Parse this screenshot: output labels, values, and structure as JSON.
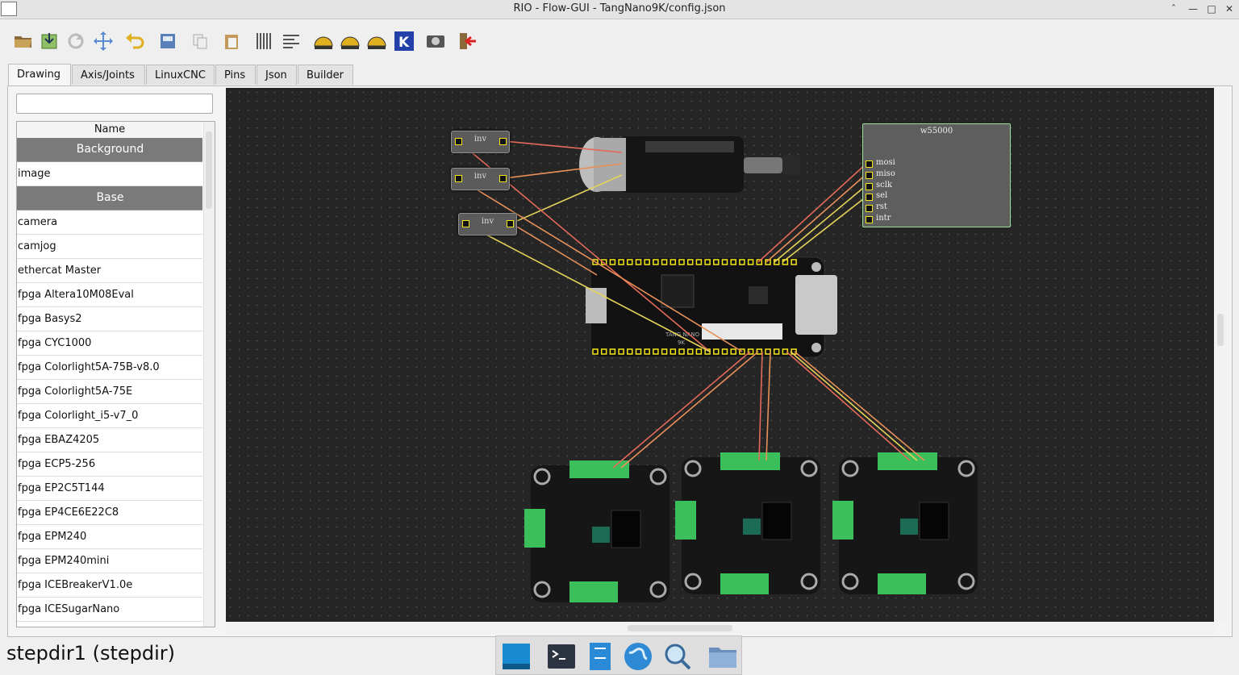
{
  "window": {
    "title": "RIO - Flow-GUI - TangNano9K/config.json"
  },
  "toolbar": {
    "icons": [
      "folder-open-icon",
      "save-download-icon",
      "reload-icon",
      "fit-view-icon",
      "undo-icon",
      "export-icon",
      "copy-icon",
      "paste-icon",
      "align-columns-icon",
      "align-text-icon",
      "linuxcnc-icon",
      "linuxcnc-alt-icon",
      "linuxcnc-run-icon",
      "kicad-icon",
      "screenshot-icon",
      "exit-icon"
    ]
  },
  "tabs": [
    "Drawing",
    "Axis/Joints",
    "LinuxCNC",
    "Pins",
    "Json",
    "Builder"
  ],
  "sidebar": {
    "search_placeholder": "",
    "header": "Name",
    "items": [
      {
        "label": "Background",
        "group": true
      },
      {
        "label": "image",
        "group": false
      },
      {
        "label": "Base",
        "group": true
      },
      {
        "label": "camera",
        "group": false
      },
      {
        "label": "camjog",
        "group": false
      },
      {
        "label": "ethercat Master",
        "group": false
      },
      {
        "label": "fpga Altera10M08Eval",
        "group": false
      },
      {
        "label": "fpga Basys2",
        "group": false
      },
      {
        "label": "fpga CYC1000",
        "group": false
      },
      {
        "label": "fpga Colorlight5A-75B-v8.0",
        "group": false
      },
      {
        "label": "fpga Colorlight5A-75E",
        "group": false
      },
      {
        "label": "fpga Colorlight_i5-v7_0",
        "group": false
      },
      {
        "label": "fpga EBAZ4205",
        "group": false
      },
      {
        "label": "fpga ECP5-256",
        "group": false
      },
      {
        "label": "fpga EP2C5T144",
        "group": false
      },
      {
        "label": "fpga EP4CE6E22C8",
        "group": false
      },
      {
        "label": "fpga EPM240",
        "group": false
      },
      {
        "label": "fpga EPM240mini",
        "group": false
      },
      {
        "label": "fpga ICEBreakerV1.0e",
        "group": false
      },
      {
        "label": "fpga ICESugarNano",
        "group": false
      }
    ]
  },
  "canvas": {
    "inv_nodes": [
      "inv",
      "inv",
      "inv"
    ],
    "w5500": {
      "title": "w55000",
      "pins": [
        "mosi",
        "miso",
        "sclk",
        "sel",
        "rst",
        "intr"
      ]
    },
    "board_text": [
      "TANG NANO",
      "9K"
    ]
  },
  "status": "stepdir1 (stepdir)",
  "dock": {
    "icons": [
      "desktop-icon",
      "terminal-icon",
      "file-manager-icon",
      "web-browser-icon",
      "search-icon",
      "folder-icon"
    ]
  }
}
